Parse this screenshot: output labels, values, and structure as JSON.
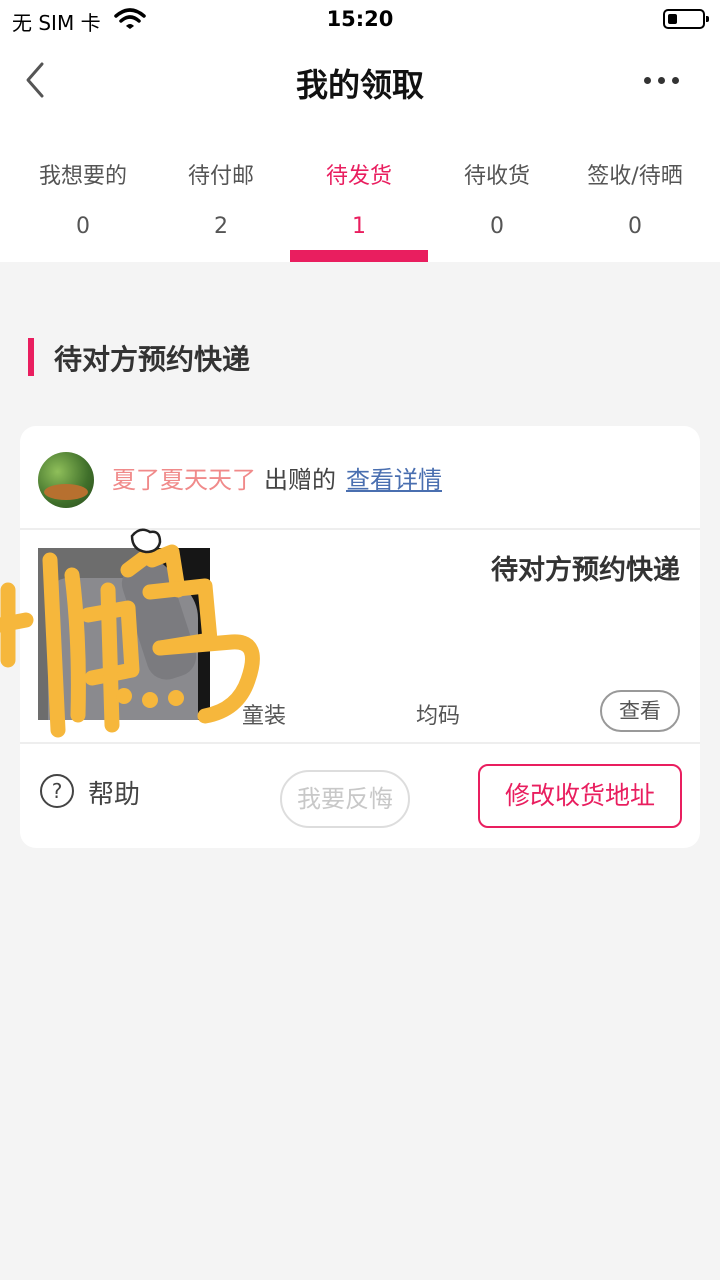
{
  "status_bar": {
    "carrier": "无 SIM 卡",
    "time": "15:20"
  },
  "nav": {
    "title": "我的领取",
    "back_icon": "chevron-left-icon",
    "more_icon": "more-dots-icon"
  },
  "tabs": [
    {
      "label": "我想要的",
      "count": "0"
    },
    {
      "label": "待付邮",
      "count": "2"
    },
    {
      "label": "待发货",
      "count": "1",
      "active": true
    },
    {
      "label": "待收货",
      "count": "0"
    },
    {
      "label": "签收/待晒",
      "count": "0"
    }
  ],
  "section": {
    "title": "待对方预约快递"
  },
  "card": {
    "giver_name": "夏了夏天天了",
    "giver_verb": "出赠的",
    "detail_link": "查看详情",
    "status": "待对方预约快递",
    "category": "童装",
    "size": "均码",
    "view_button": "查看",
    "help_label": "帮助",
    "help_icon_glyph": "?",
    "regret_button": "我要反悔",
    "address_button": "修改收货地址"
  },
  "colors": {
    "accent": "#e91e5f",
    "giver_name": "#f08a8a",
    "link": "#4a6fb0",
    "background": "#f4f4f4",
    "sticker": "#f6b73c"
  }
}
